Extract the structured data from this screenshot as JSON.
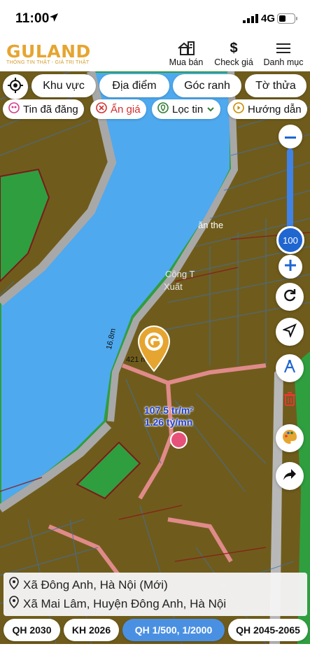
{
  "status": {
    "time": "11:00",
    "network": "4G"
  },
  "header": {
    "logo_text": "GULAND",
    "logo_tagline": "THÔNG TIN THẬT - GIÁ TRỊ THẬT",
    "buttons": [
      {
        "label": "Mua bán",
        "icon": "house-building-icon"
      },
      {
        "label": "Check giá",
        "icon": "dollar-icon"
      },
      {
        "label": "Danh mục",
        "icon": "menu-icon"
      }
    ]
  },
  "filters": {
    "row1": [
      "Khu vực",
      "Địa điểm",
      "Góc ranh",
      "Tờ thửa"
    ],
    "row2": [
      {
        "label": "Tin đã đăng",
        "icon": "posted-icon",
        "color": "#d63a8a"
      },
      {
        "label": "Ẩn giá",
        "icon": "hide-price-icon",
        "color": "#d32f2f"
      },
      {
        "label": "Lọc tin",
        "icon": "location-filter-icon",
        "color": "#2e7d32"
      },
      {
        "label": "Hướng dẫn",
        "icon": "play-guide-icon",
        "color": "#c98a00"
      }
    ]
  },
  "zoom": {
    "value": "100"
  },
  "map_labels": {
    "edge_length": "16.8m",
    "area_partial": "421 m",
    "place_partial_1": "Công T",
    "place_partial_2": "Xuất",
    "place_partial_3": "ăn the"
  },
  "price": {
    "per_m2": "107.5 tr/m²",
    "total": "1.26 tỷ/mn"
  },
  "address": {
    "line1": "Xã Đông Anh, Hà Nội (Mới)",
    "line2": "Xã Mai Lâm, Huyện Đông Anh, Hà Nội"
  },
  "plans": [
    {
      "label": "QH 2030",
      "active": false
    },
    {
      "label": "KH 2026",
      "active": false
    },
    {
      "label": "QH 1/500, 1/2000",
      "active": true
    },
    {
      "label": "QH 2045-2065",
      "active": false
    }
  ],
  "colors": {
    "water": "#4ea9ef",
    "land": "#6f5c1c",
    "green": "#2f9e3f",
    "road": "#b8b8b8",
    "accent": "#e6a530",
    "active_tab": "#4a90e2"
  }
}
